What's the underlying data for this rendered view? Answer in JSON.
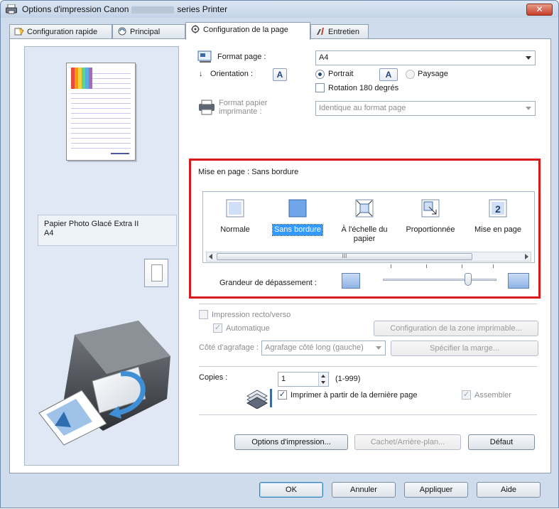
{
  "window": {
    "title_prefix": "Options d'impression Canon",
    "title_suffix": "series Printer",
    "close_label": "✕"
  },
  "tabs": [
    {
      "label": "Configuration rapide"
    },
    {
      "label": "Principal"
    },
    {
      "label": "Configuration de la page"
    },
    {
      "label": "Entretien"
    }
  ],
  "preview": {
    "media_line1": "Papier Photo Glacé Extra II",
    "media_line2": "A4"
  },
  "page": {
    "format_label": "Format page :",
    "format_value": "A4",
    "orientation_label": "Orientation :",
    "orientation_icon_letter": "A",
    "portrait_label": "Portrait",
    "landscape_label": "Paysage",
    "rotation_label": "Rotation 180 degrés",
    "printer_format_label_1": "Format papier",
    "printer_format_label_2": "imprimante :",
    "printer_format_value": "Identique au format page"
  },
  "layout": {
    "heading": "Mise en page :",
    "current": "Sans bordure",
    "items": [
      {
        "label": "Normale"
      },
      {
        "label": "Sans bordure"
      },
      {
        "label": "À l'échelle du papier"
      },
      {
        "label": "Proportionnée"
      },
      {
        "label": "Mise en page"
      }
    ],
    "scroll_thumb": "III",
    "exceed_label": "Grandeur de dépassement :",
    "exceed_level": 0.75
  },
  "duplex": {
    "label": "Impression recto/verso",
    "auto_label": "Automatique",
    "print_area_button": "Configuration de la zone imprimable...",
    "staple_label": "Côté d'agrafage :",
    "staple_value": "Agrafage côté long (gauche)",
    "margin_button": "Spécifier la marge..."
  },
  "copies": {
    "label": "Copies :",
    "value": "1",
    "range": "(1-999)",
    "last_page_label": "Imprimer à partir de la dernière page",
    "collate_label": "Assembler"
  },
  "actions": {
    "print_options": "Options d'impression...",
    "stamp_background": "Cachet/Arrière-plan...",
    "defaults": "Défaut"
  },
  "dialog_buttons": {
    "ok": "OK",
    "cancel": "Annuler",
    "apply": "Appliquer",
    "help": "Aide"
  },
  "colors": {
    "highlight": "#d91a1a",
    "selection": "#3399ff"
  }
}
